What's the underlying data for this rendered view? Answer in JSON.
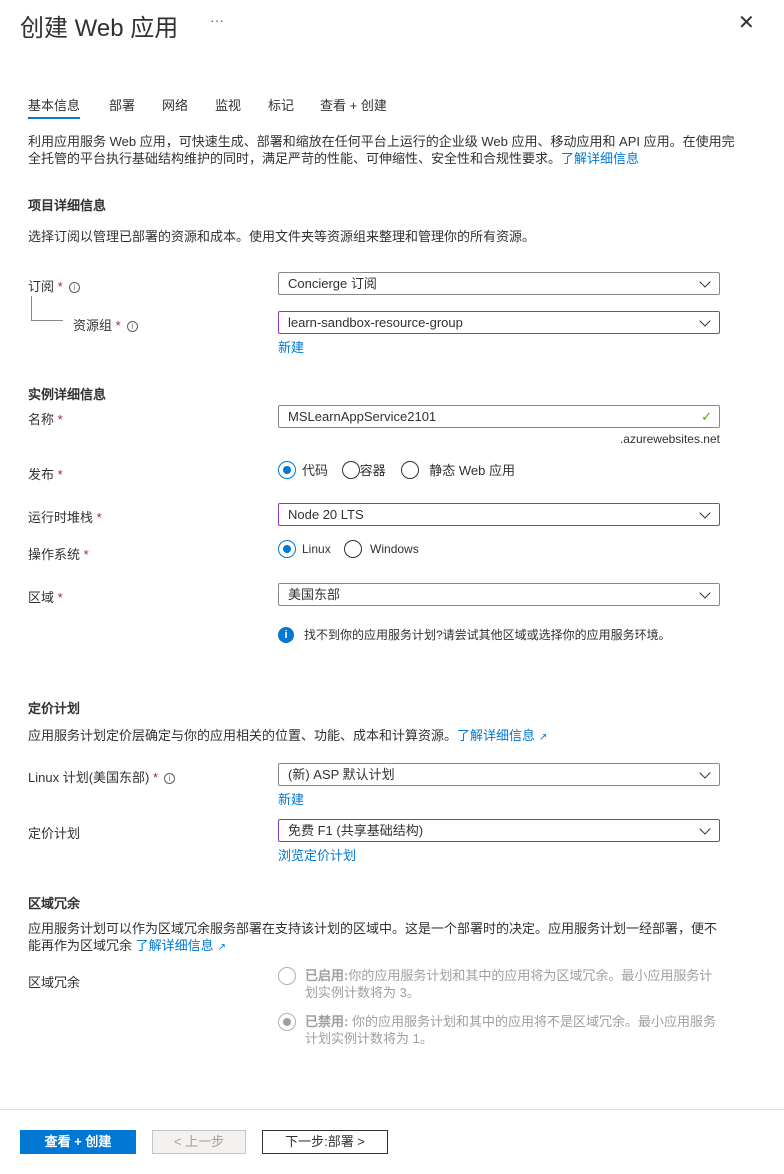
{
  "header": {
    "title": "创建 Web 应用",
    "more": "···",
    "close": "✕"
  },
  "tabs": [
    "基本信息",
    "部署",
    "网络",
    "监视",
    "标记",
    "查看 + 创建"
  ],
  "intro": {
    "text": "利用应用服务 Web 应用，可快速生成、部署和缩放在任何平台上运行的企业级 Web 应用、移动应用和 API 应用。在使用完全托管的平台执行基础结构维护的同时，满足严苛的性能、可伸缩性、安全性和合规性要求。",
    "link": "了解详细信息"
  },
  "project": {
    "heading": "项目详细信息",
    "desc": "选择订阅以管理已部署的资源和成本。使用文件夹等资源组来整理和管理你的所有资源。",
    "subscription_label": "订阅",
    "subscription_value": "Concierge 订阅",
    "rg_label": "资源组",
    "rg_value": "learn-sandbox-resource-group",
    "rg_new": "新建"
  },
  "instance": {
    "heading": "实例详细信息",
    "name_label": "名称",
    "name_value": "MSLearnAppService2101",
    "name_suffix": ".azurewebsites.net",
    "publish_label": "发布",
    "publish_options": [
      "代码",
      "容器",
      "静态 Web 应用"
    ],
    "runtime_label": "运行时堆栈",
    "runtime_value": "Node 20 LTS",
    "os_label": "操作系统",
    "os_options": [
      "Linux",
      "Windows"
    ],
    "region_label": "区域",
    "region_value": "美国东部",
    "region_info": "找不到你的应用服务计划?请尝试其他区域或选择你的应用服务环境。"
  },
  "pricing": {
    "heading": "定价计划",
    "desc": "应用服务计划定价层确定与你的应用相关的位置、功能、成本和计算资源。",
    "link": "了解详细信息",
    "plan_label": "Linux 计划(美国东部)",
    "plan_value": "(新) ASP 默认计划",
    "plan_new": "新建",
    "tier_label": "定价计划",
    "tier_value": "免费 F1 (共享基础结构)",
    "tier_browse": "浏览定价计划"
  },
  "zone": {
    "heading": "区域冗余",
    "desc": "应用服务计划可以作为区域冗余服务部署在支持该计划的区域中。这是一个部署时的决定。应用服务计划一经部署，便不能再作为区域冗余",
    "link": "了解详细信息",
    "label": "区域冗余",
    "enabled_title": "已启用:",
    "enabled_text": "你的应用服务计划和其中的应用将为区域冗余。最小应用服务计划实例计数将为 3。",
    "disabled_title": "已禁用:",
    "disabled_text": " 你的应用服务计划和其中的应用将不是区域冗余。最小应用服务计划实例计数将为 1。"
  },
  "footer": {
    "review": "查看 + 创建",
    "prev": "< 上一步",
    "next": "下一步:部署 >"
  },
  "colors": {
    "accent": "#0078d4",
    "focus": "#8a3ab9",
    "valid": "#57a300"
  }
}
